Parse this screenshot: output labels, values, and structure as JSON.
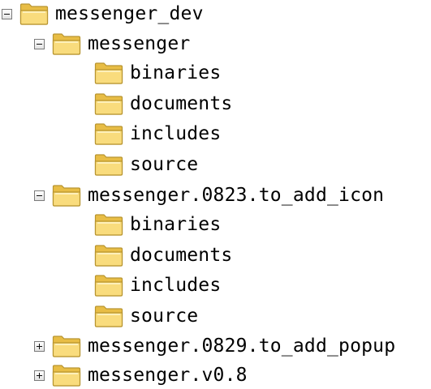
{
  "colors": {
    "folder_fill": "#f7d775",
    "folder_edge": "#b89530",
    "toggle_border": "#7a7a7a"
  },
  "tree": {
    "root": {
      "label": "messenger_dev",
      "state": "expanded",
      "icon": "folder-icon"
    },
    "messenger": {
      "label": "messenger",
      "state": "expanded",
      "icon": "folder-icon",
      "children": [
        "binaries",
        "documents",
        "includes",
        "source"
      ]
    },
    "to_add_icon": {
      "label": "messenger.0823.to_add_icon",
      "state": "expanded",
      "icon": "folder-icon",
      "children": [
        "binaries",
        "documents",
        "includes",
        "source"
      ]
    },
    "to_add_popup": {
      "label": "messenger.0829.to_add_popup",
      "state": "collapsed",
      "icon": "folder-icon"
    },
    "v08": {
      "label": "messenger.v0.8",
      "state": "collapsed",
      "icon": "folder-icon"
    }
  }
}
